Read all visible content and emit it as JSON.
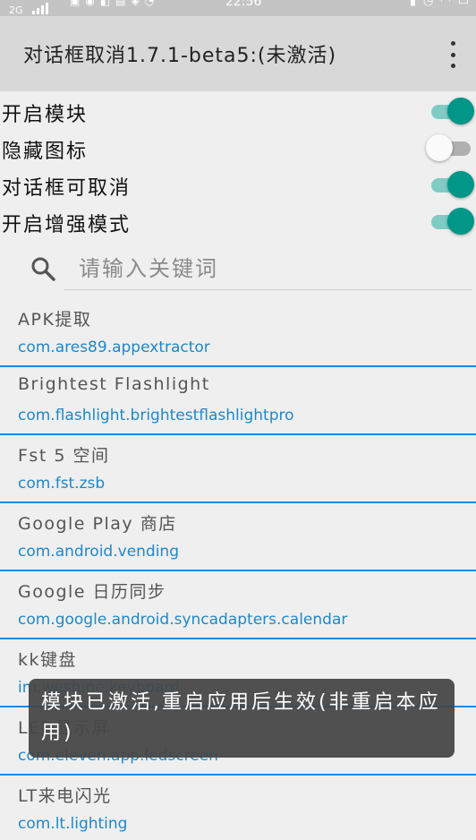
{
  "status_bar": {
    "network": "2G",
    "time": "22:56"
  },
  "toolbar": {
    "title": "对话框取消1.7.1-beta5:(未激活)",
    "menu_icon": "more-vert-icon"
  },
  "switches": [
    {
      "label": "开启模块",
      "on": true
    },
    {
      "label": "隐藏图标",
      "on": false
    },
    {
      "label": "对话框可取消",
      "on": true
    },
    {
      "label": "开启增强模式",
      "on": true
    }
  ],
  "search": {
    "placeholder": "请输入关键词",
    "icon": "search-icon"
  },
  "apps": [
    {
      "name": "APK提取",
      "package": "com.ares89.appextractor"
    },
    {
      "name": "Brightest Flashlight",
      "package": "com.flashlight.brightestflashlightpro"
    },
    {
      "name": "Fst 5 空间",
      "package": "com.fst.zsb"
    },
    {
      "name": "Google Play 商店",
      "package": "com.android.vending"
    },
    {
      "name": "Google 日历同步",
      "package": "com.google.android.syncadapters.calendar"
    },
    {
      "name": "kk键盘",
      "package": "im.weshine.keyboard"
    },
    {
      "name": "LED显示屏",
      "package": "com.eleven.app.ledscreen"
    },
    {
      "name": "LT来电闪光",
      "package": "com.lt.lighting"
    }
  ],
  "toast": {
    "message": "模块已激活,重启应用后生效(非重启本应用)"
  },
  "colors": {
    "accent": "#009688",
    "package_text": "#1e88c9",
    "divider": "#1e88e5"
  }
}
